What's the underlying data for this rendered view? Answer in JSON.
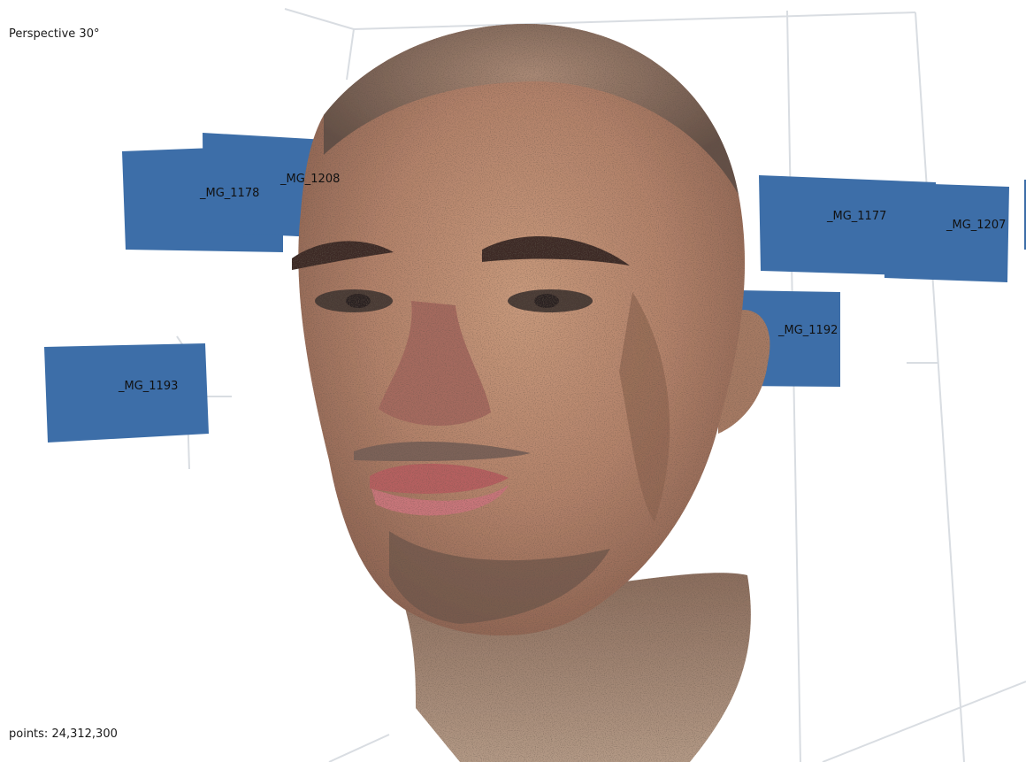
{
  "viewer": {
    "projection_label": "Perspective 30°",
    "points_label": "points: 24,312,300"
  },
  "cameras": [
    {
      "label": "_MG_1178"
    },
    {
      "label": "_MG_1208"
    },
    {
      "label": "_MG_1177"
    },
    {
      "label": "_MG_1207"
    },
    {
      "label": "_MG_1192"
    },
    {
      "label": "_MG_1193"
    }
  ],
  "colors": {
    "background": "#ffffff",
    "camera_plane": "#3d6ea8",
    "bounding_box": "#d9dde2",
    "text": "#1a1a1a",
    "skin_base": "#b98a6c"
  },
  "icons": {
    "camera": "camera-plane-icon",
    "model": "point-cloud-model"
  }
}
